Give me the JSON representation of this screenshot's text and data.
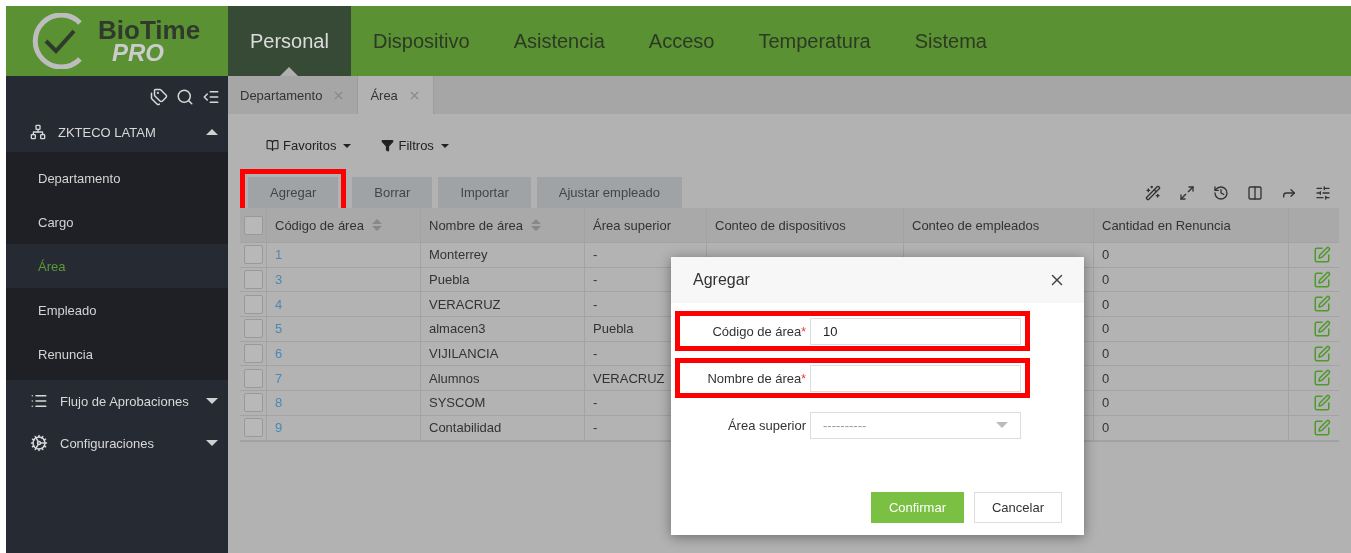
{
  "logo": {
    "name": "BioTime",
    "sub": "PRO"
  },
  "nav": [
    {
      "label": "Personal",
      "selected": true
    },
    {
      "label": "Dispositivo",
      "selected": false
    },
    {
      "label": "Asistencia",
      "selected": false
    },
    {
      "label": "Acceso",
      "selected": false
    },
    {
      "label": "Temperatura",
      "selected": false
    },
    {
      "label": "Sistema",
      "selected": false
    }
  ],
  "sidebar": {
    "group": {
      "label": "ZKTECO LATAM",
      "expanded": true
    },
    "items": [
      {
        "label": "Departamento",
        "selected": false
      },
      {
        "label": "Cargo",
        "selected": false
      },
      {
        "label": "Área",
        "selected": true
      },
      {
        "label": "Empleado",
        "selected": false
      },
      {
        "label": "Renuncia",
        "selected": false
      }
    ],
    "sections": [
      {
        "kind": "list",
        "label": "Flujo de Aprobaciones",
        "expanded": false
      },
      {
        "kind": "cogs",
        "label": "Configuraciones",
        "expanded": false
      }
    ]
  },
  "tabs": [
    {
      "label": "Departamento",
      "selected": false
    },
    {
      "label": "Área",
      "selected": true
    }
  ],
  "filters": [
    {
      "kind": "book",
      "label": "Favoritos"
    },
    {
      "kind": "filter",
      "label": "Filtros"
    }
  ],
  "actions": [
    {
      "label": "Agregar",
      "highlighted": true
    },
    {
      "label": "Borrar",
      "highlighted": false
    },
    {
      "label": "Importar",
      "highlighted": false
    },
    {
      "label": "Ajustar empleado",
      "highlighted": false
    }
  ],
  "table": {
    "all_checked": false,
    "columns": [
      {
        "label": "Código de área",
        "sortable": true
      },
      {
        "label": "Nombre de área",
        "sortable": true
      },
      {
        "label": "Área superior",
        "sortable": false
      },
      {
        "label": "Conteo de dispositivos",
        "sortable": false
      },
      {
        "label": "Conteo de empleados",
        "sortable": false
      },
      {
        "label": "Cantidad en Renuncia",
        "sortable": false
      }
    ],
    "rows": [
      {
        "checked": false,
        "code": "1",
        "name": "Monterrey",
        "parent": "-",
        "resigned": "0"
      },
      {
        "checked": false,
        "code": "3",
        "name": "Puebla",
        "parent": "-",
        "resigned": "0"
      },
      {
        "checked": false,
        "code": "4",
        "name": "VERACRUZ",
        "parent": "-",
        "resigned": "0"
      },
      {
        "checked": false,
        "code": "5",
        "name": "almacen3",
        "parent": "Puebla",
        "resigned": "0"
      },
      {
        "checked": false,
        "code": "6",
        "name": "VIJILANCIA",
        "parent": "-",
        "resigned": "0"
      },
      {
        "checked": false,
        "code": "7",
        "name": "Alumnos",
        "parent": "VERACRUZ",
        "resigned": "0"
      },
      {
        "checked": false,
        "code": "8",
        "name": "SYSCOM",
        "parent": "-",
        "resigned": "0"
      },
      {
        "checked": false,
        "code": "9",
        "name": "Contabilidad",
        "parent": "-",
        "resigned": "0"
      }
    ]
  },
  "dialog": {
    "title": "Agregar",
    "fields": [
      {
        "kind": "text",
        "label": "Código de área",
        "required_mark": "*",
        "value": "10",
        "highlighted": true
      },
      {
        "kind": "text",
        "label": "Nombre de área",
        "required_mark": "*",
        "highlighted": true
      },
      {
        "kind": "select",
        "label": "Área superior",
        "value": "----------",
        "highlighted": false
      }
    ],
    "buttons": [
      {
        "label": "Confirmar",
        "primary": true
      },
      {
        "label": "Cancelar",
        "primary": false
      }
    ]
  }
}
